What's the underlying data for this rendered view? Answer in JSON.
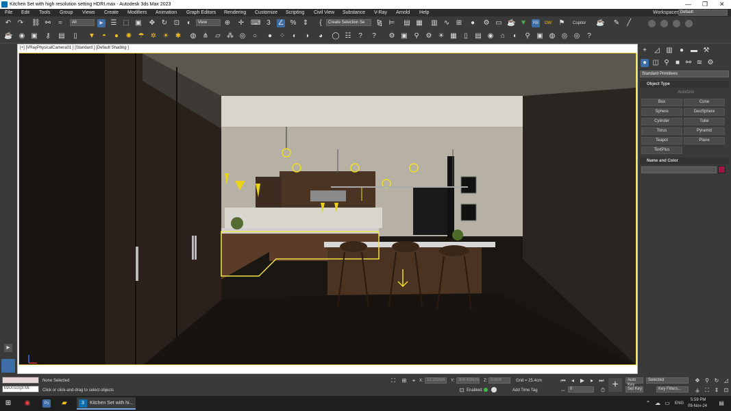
{
  "window": {
    "title": "Kitchen Set with high resolution setting HDRI.max - Autodesk 3ds Max 2023",
    "controls": [
      "—",
      "❐",
      "✕"
    ]
  },
  "menu": {
    "items": [
      "File",
      "Edit",
      "Tools",
      "Group",
      "Views",
      "Create",
      "Modifiers",
      "Animation",
      "Graph Editors",
      "Rendering",
      "Customize",
      "Scripting",
      "Civil View",
      "Substance",
      "V-Ray",
      "Arnold",
      "Help"
    ],
    "workspaces_label": "Workspaces:",
    "workspaces_value": "Default"
  },
  "toolbar": {
    "filter_value": "All",
    "ref_coord_value": "View",
    "selection_set_value": "Create Selection Se",
    "copitor_label": "Copitor",
    "rb_label": "RB",
    "ow_label": "OW"
  },
  "viewport": {
    "label": "[+] [VRayPhysicalCamera01 ] [Standard ] [Default Shading ]"
  },
  "command_panel": {
    "category_value": "Standard Primitives",
    "object_type_header": "Object Type",
    "autogrid_label": "AutoGrid",
    "buttons": [
      "Box",
      "Cone",
      "Sphere",
      "GeoSphere",
      "Cylinder",
      "Tube",
      "Torus",
      "Pyramid",
      "Teapot",
      "Plane",
      "TextPlus"
    ],
    "name_color_header": "Name and Color",
    "object_color": "#9c1844"
  },
  "status": {
    "selection": "None Selected",
    "prompt": "Click or click-and-drag to select objects",
    "maxscript_label": "MAXScript Mi:",
    "x_label": "X:",
    "x_value": "12.332cm",
    "y_label": "Y:",
    "y_value": "304.438cm",
    "z_label": "Z:",
    "z_value": "0.0cm",
    "grid": "Grid = 25.4cm",
    "enabled_label": "Enabled:",
    "add_time_tag": "Add Time Tag",
    "frame_value": "0",
    "auto_key": "Auto Key",
    "set_key": "Set Key",
    "key_mode_value": "Selected",
    "key_filters": "Key Filters..."
  },
  "taskbar": {
    "app_label": "Kitchen Set with hi...",
    "time": "5:59 PM",
    "date": "09-Nov-24",
    "lang": "ENG"
  }
}
